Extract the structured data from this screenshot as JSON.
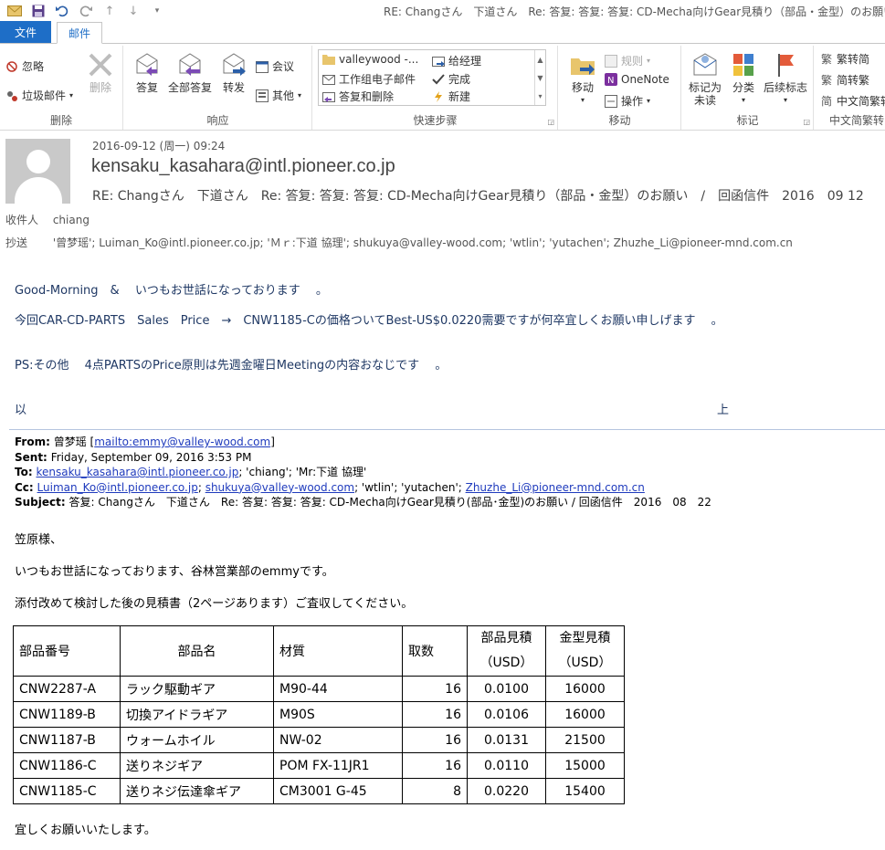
{
  "window": {
    "title": "RE: Changさん　下道さん　Re: 答复: 答复: 答复: CD-Mecha向けGear見積り（部品・金型）のお願い"
  },
  "tabs": {
    "file": "文件",
    "mail": "邮件"
  },
  "ribbon": {
    "delete_group": {
      "ignore": "忽略",
      "junk": "垃圾邮件",
      "delete": "删除",
      "label": "删除"
    },
    "respond_group": {
      "reply": "答复",
      "reply_all": "全部答复",
      "forward": "转发",
      "meeting": "会议",
      "more": "其他",
      "label": "响应"
    },
    "quicksteps_group": {
      "items": [
        "valleywood -...",
        "工作组电子邮件",
        "答复和删除",
        "给经理",
        "完成",
        "新建"
      ],
      "label": "快速步骤"
    },
    "move_group": {
      "move": "移动",
      "rules": "规则",
      "onenote": "OneNote",
      "actions": "操作",
      "label": "移动"
    },
    "tags_group": {
      "unread": "标记为\n未读",
      "categorize": "分类",
      "followup": "后续标志",
      "label": "标记"
    },
    "chinese_group": {
      "to_trad": "繁转简",
      "to_simp": "简转繁",
      "convert": "中文简繁转",
      "label": "中文简繁转"
    }
  },
  "header": {
    "date": "2016-09-12 (周一) 09:24",
    "sender": "kensaku_kasahara@intl.pioneer.co.jp",
    "subject": "RE: Changさん　下道さん　Re: 答复: 答复: 答复: CD-Mecha向けGear見積り（部品・金型）のお願い　/　回函信件　2016　09  12",
    "to_label": "收件人",
    "to_value": "chiang",
    "cc_label": "抄送",
    "cc_value": "'曾梦瑶'; Luiman_Ko@intl.pioneer.co.jp; 'Ｍｒ:下道 協理'; shukuya@valley-wood.com; 'wtlin'; 'yutachen'; Zhuzhe_Li@pioneer-mnd.com.cn"
  },
  "body": {
    "line1": "Good-Morning　&　 いつもお世話になっております　 。",
    "line2": "今回CAR-CD-PARTS　Sales　Price　→　CNW1185-Cの価格ついてBest-US$0.0220需要ですが何卒宜しくお願い申しげます　 。",
    "line3": "PS:その他　 4点PARTSのPrice原則は先週金曜日Meetingの内容おなじです　 。",
    "closing_left": "以",
    "closing_right": "上"
  },
  "quoted": {
    "from_label": "From:",
    "from_name": "曾梦瑶 [",
    "from_link": "mailto:emmy@valley-wood.com",
    "from_end": "]",
    "sent_label": "Sent:",
    "sent_value": "Friday, September 09, 2016 3:53 PM",
    "to_label": "To:",
    "to_link": "kensaku_kasahara@intl.pioneer.co.jp",
    "to_rest": "; 'chiang'; 'Mr:下道 協理'",
    "cc_label": "Cc:",
    "cc_link1": "Luiman_Ko@intl.pioneer.co.jp",
    "cc_sep1": "; ",
    "cc_link2": "shukuya@valley-wood.com",
    "cc_mid": "; 'wtlin'; 'yutachen'; ",
    "cc_link3": "Zhuzhe_Li@pioneer-mnd.com.cn",
    "subject_label": "Subject:",
    "subject_value": "答复: Changさん　下道さん　Re: 答复: 答复: 答复: CD-Mecha向けGear見積り(部品･金型)のお願い / 回函信件　2016　08　22",
    "greeting": "笠原様、",
    "para1": "いつもお世話になっております、谷林営業部のemmyです。",
    "para2": "添付改めて検討した後の見積書（2ページあります）ご査収してください。",
    "closing": "宜しくお願いいたします。"
  },
  "table": {
    "headers": [
      "部品番号",
      "部品名",
      "材質",
      "取数",
      "部品見積\n（USD）",
      "金型見積\n（USD）"
    ],
    "rows": [
      [
        "CNW2287-A",
        "ラック駆動ギア",
        "M90-44",
        "16",
        "0.0100",
        "16000"
      ],
      [
        "CNW1189-B",
        "切換アイドラギア",
        "M90S",
        "16",
        "0.0106",
        "16000"
      ],
      [
        "CNW1187-B",
        "ウォームホイル",
        "NW-02",
        "16",
        "0.0131",
        "21500"
      ],
      [
        "CNW1186-C",
        "送りネジギア",
        "POM  FX-11JR1",
        "16",
        "0.0110",
        "15000"
      ],
      [
        "CNW1185-C",
        "送りネジ伝達傘ギア",
        "CM3001  G-45",
        "8",
        "0.0220",
        "15400"
      ]
    ]
  }
}
